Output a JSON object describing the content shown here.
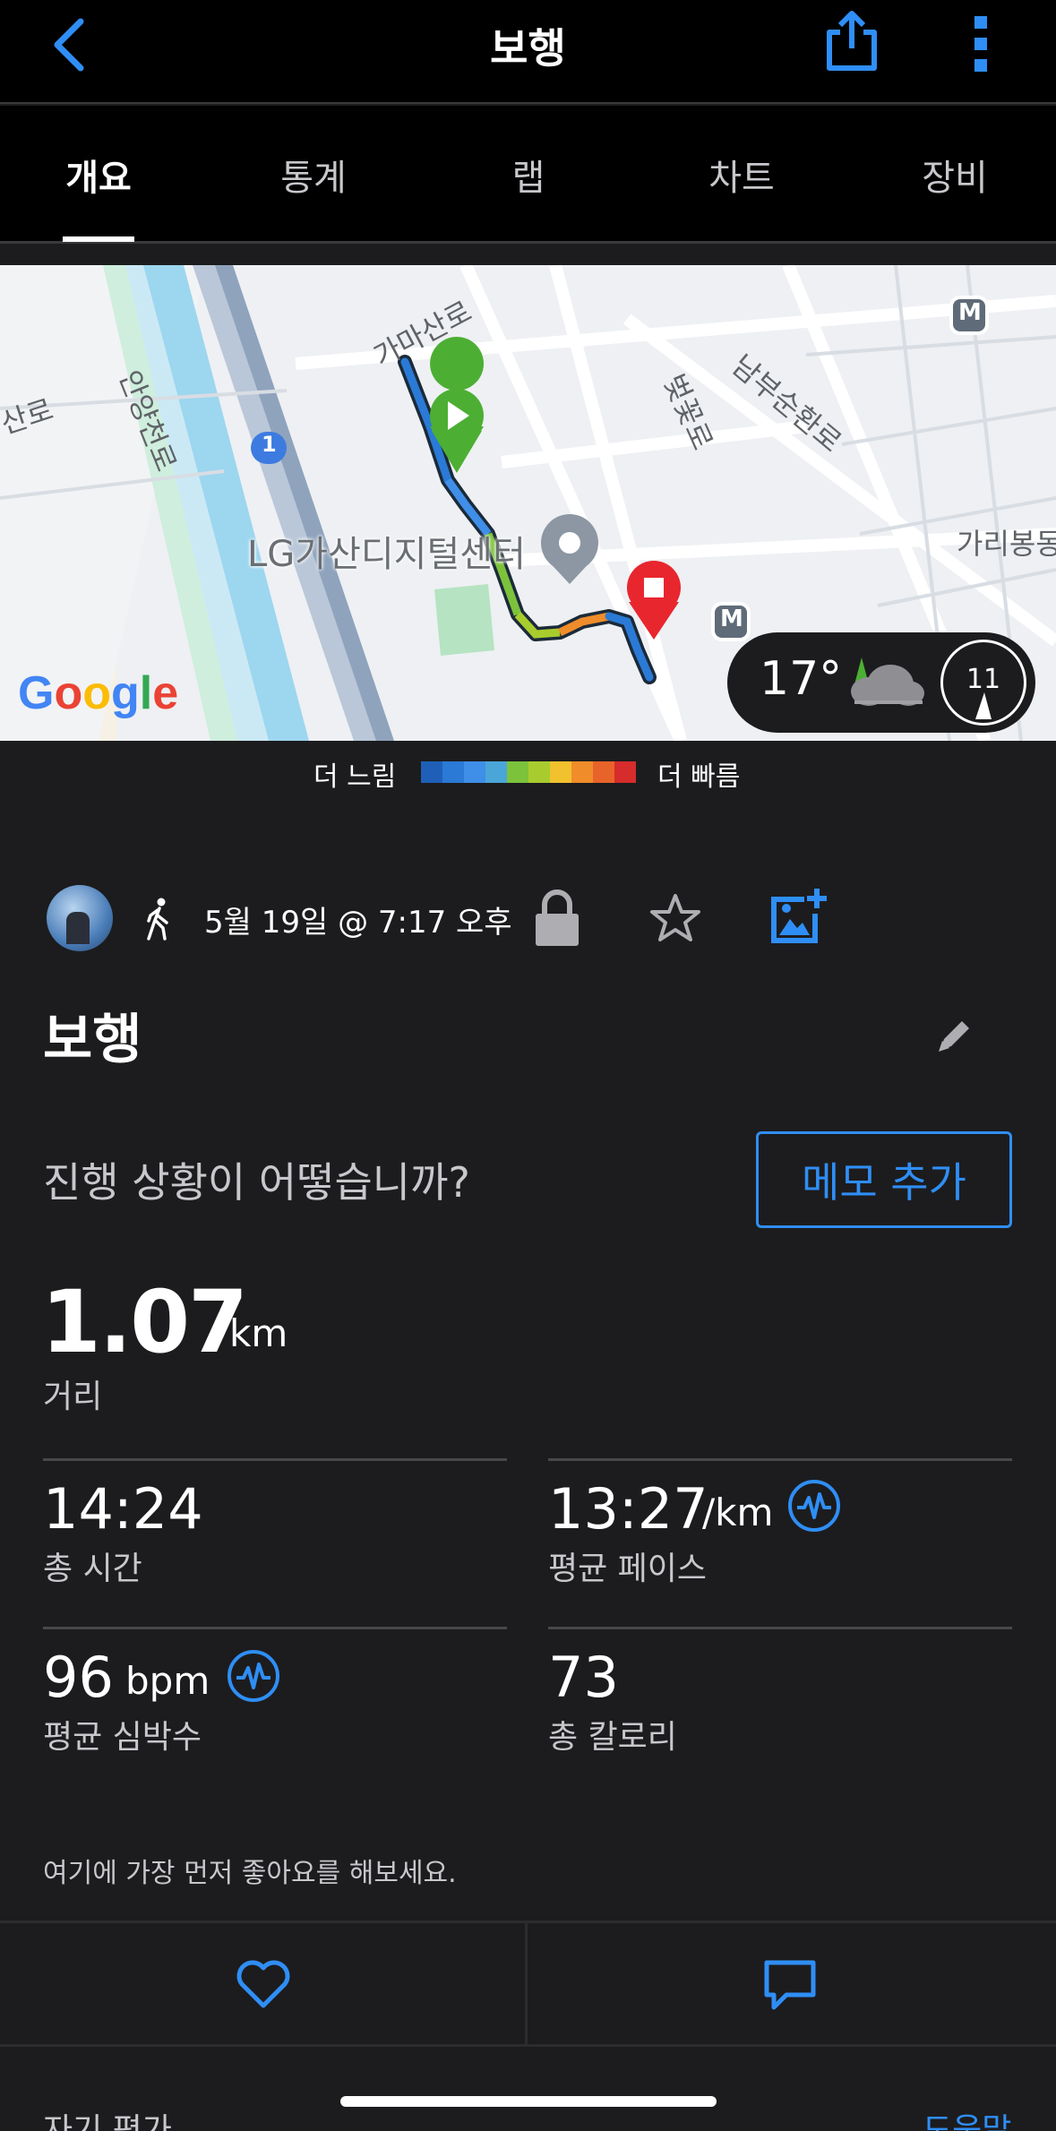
{
  "header": {
    "title": "보행",
    "back_icon": "chevron-left-icon",
    "share_icon": "share-icon",
    "more_icon": "more-vertical-icon",
    "accent_color": "#2f8ef5"
  },
  "tabs": [
    {
      "label": "개요",
      "active": true
    },
    {
      "label": "통계",
      "active": false
    },
    {
      "label": "랩",
      "active": false
    },
    {
      "label": "차트",
      "active": false
    },
    {
      "label": "장비",
      "active": false
    }
  ],
  "map": {
    "labels": {
      "road1": "가마산로",
      "road2": "안양천로",
      "road3": "산로",
      "road4": "벚꽃로",
      "road5": "남부순환로",
      "area1": "가리봉동",
      "poi": "LG가산디지털센터",
      "route_badge": "1",
      "metro1": "M",
      "metro2": "M"
    },
    "google": "Google",
    "weather": {
      "temperature": "17°",
      "wind_speed": "11"
    }
  },
  "legend": {
    "slow_label": "더 느림",
    "fast_label": "더 빠름",
    "colors": [
      "#1f5fb8",
      "#2a7ad6",
      "#3f8ee8",
      "#4aa6d8",
      "#7cc23b",
      "#a8cc2e",
      "#f2c12e",
      "#f08c2a",
      "#e8632a",
      "#d62c2c"
    ]
  },
  "activity": {
    "date": "5월 19일 @ 7:17 오후",
    "title": "보행",
    "question": "진행 상황이 어떻습니까?",
    "memo_button": "메모 추가"
  },
  "stats": {
    "distance": {
      "value": "1.07",
      "unit": "km",
      "label": "거리"
    },
    "total_time": {
      "value": "14:24",
      "label": "총 시간"
    },
    "avg_pace": {
      "value": "13:27",
      "unit": "/km",
      "label": "평균 페이스"
    },
    "avg_hr": {
      "value": "96",
      "unit": "bpm",
      "label": "평균 심박수"
    },
    "calories": {
      "value": "73",
      "label": "총 칼로리"
    }
  },
  "social": {
    "like_prompt": "여기에 가장 먼저 좋아요를 해보세요."
  },
  "footer": {
    "self_eval": "자기 평가",
    "help": "도움말"
  }
}
